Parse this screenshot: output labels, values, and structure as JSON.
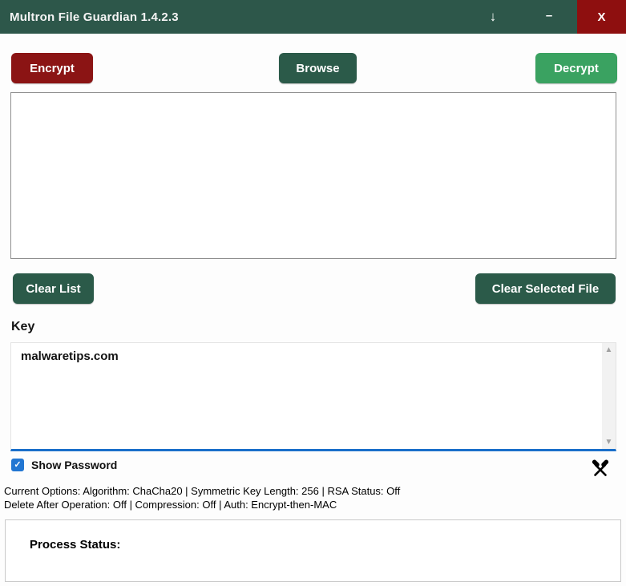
{
  "window": {
    "title": "Multron File Guardian 1.4.2.3",
    "controls": {
      "arrow_down_glyph": "↓",
      "minimize_glyph": "–",
      "close_glyph": "X"
    }
  },
  "toolbar": {
    "encrypt_label": "Encrypt",
    "browse_label": "Browse",
    "decrypt_label": "Decrypt"
  },
  "file_list": {
    "items": []
  },
  "list_actions": {
    "clear_list_label": "Clear List",
    "clear_selected_label": "Clear Selected File"
  },
  "key_section": {
    "label": "Key",
    "value": "malwaretips.com",
    "scroll_up_glyph": "▲",
    "scroll_down_glyph": "▼"
  },
  "password": {
    "show_password_label": "Show Password",
    "checked": true,
    "check_glyph": "✓"
  },
  "options_bar": {
    "tools_icon_name": "crossed-hammers",
    "line1": "Current Options: Algorithm: ChaCha20 | Symmetric Key Length: 256 | RSA Status: Off",
    "line2": "Delete After Operation: Off | Compression: Off | Auth: Encrypt-then-MAC"
  },
  "process_status": {
    "label": "Process Status:",
    "value": ""
  },
  "colors": {
    "titlebar_green": "#2d574a",
    "close_red": "#8e0f0f",
    "encrypt_red": "#8b1414",
    "dark_green_button": "#2b5a49",
    "decrypt_green": "#3aa261",
    "accent_blue": "#1a6fca",
    "checkbox_blue": "#2176d2"
  }
}
